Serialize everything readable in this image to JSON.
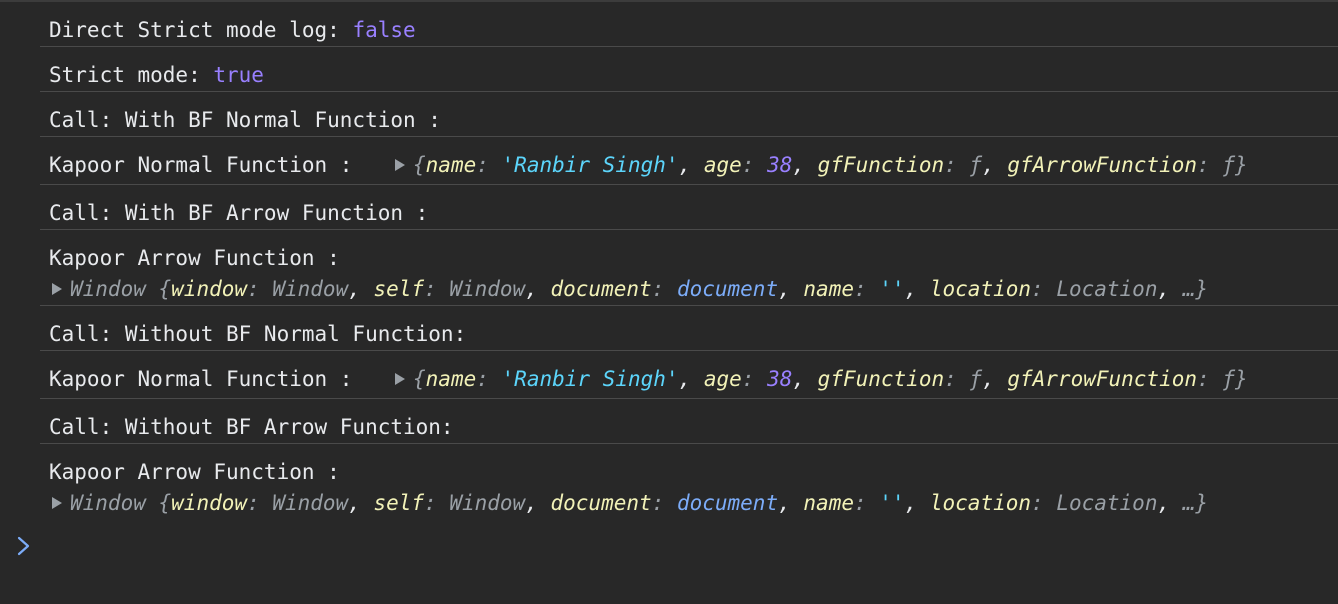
{
  "logs": [
    {
      "text": "Direct Strict mode log: ",
      "value": "false"
    },
    {
      "text": "Strict mode: ",
      "value": "true"
    },
    {
      "text": "Call: With BF Normal Function :"
    },
    {
      "text": "Kapoor Normal Function :",
      "object": {
        "open": "{",
        "k1": "name",
        "v1": "'Ranbir Singh'",
        "k2": "age",
        "v2": "38",
        "k3": "gfFunction",
        "v3": "ƒ",
        "k4": "gfArrowFunction",
        "v4": "ƒ",
        "close": "}"
      }
    },
    {
      "text": "Call: With BF Arrow Function :"
    },
    {
      "text": "Kapoor Arrow Function :",
      "window": {
        "prefix": "Window {",
        "k1": "window",
        "v1": "Window",
        "k2": "self",
        "v2": "Window",
        "k3": "document",
        "v3": "document",
        "k4": "name",
        "v4": "''",
        "k5": "location",
        "v5": "Location",
        "suffix": "…}"
      }
    },
    {
      "text": "Call: Without BF Normal Function:"
    },
    {
      "text": "Kapoor Normal Function :",
      "object": {
        "open": "{",
        "k1": "name",
        "v1": "'Ranbir Singh'",
        "k2": "age",
        "v2": "38",
        "k3": "gfFunction",
        "v3": "ƒ",
        "k4": "gfArrowFunction",
        "v4": "ƒ",
        "close": "}"
      }
    },
    {
      "text": "Call: Without BF Arrow Function:"
    },
    {
      "text": "Kapoor Arrow Function :",
      "window": {
        "prefix": "Window {",
        "k1": "window",
        "v1": "Window",
        "k2": "self",
        "v2": "Window",
        "k3": "document",
        "v3": "document",
        "k4": "name",
        "v4": "''",
        "k5": "location",
        "v5": "Location",
        "suffix": "…}"
      }
    }
  ],
  "prompt": {
    "icon": "chevron-right-icon",
    "color": "#7cacf8"
  }
}
